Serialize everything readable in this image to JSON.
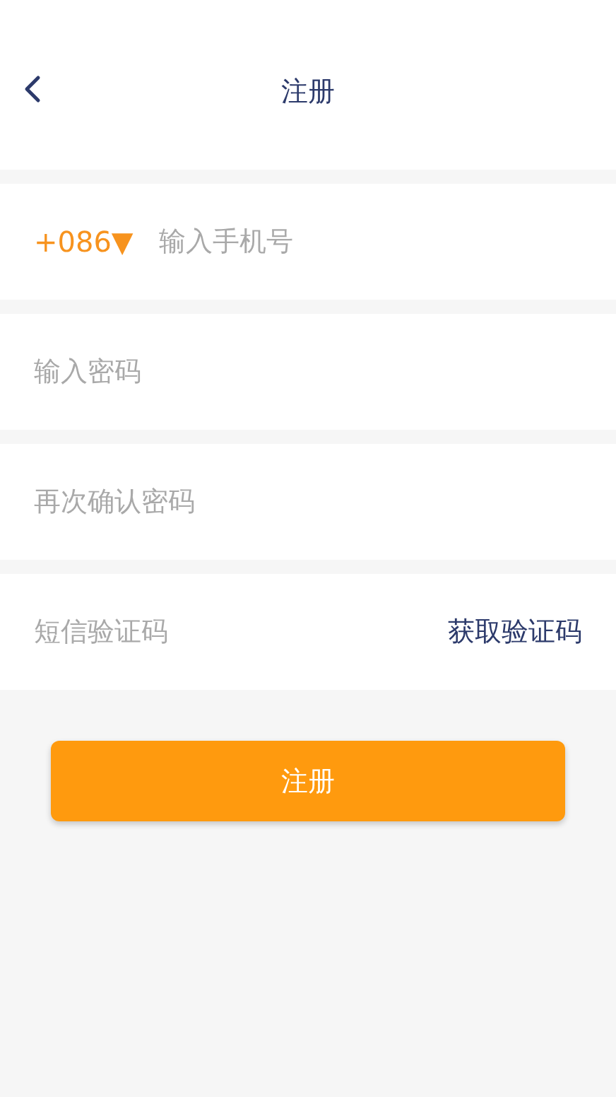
{
  "header": {
    "title": "注册"
  },
  "phone": {
    "country_code": "+086▼",
    "placeholder": "输入手机号"
  },
  "fields": [
    {
      "placeholder": "输入密码"
    },
    {
      "placeholder": "再次确认密码"
    }
  ],
  "sms": {
    "placeholder": "短信验证码",
    "action": "获取验证码"
  },
  "submit": "注册"
}
